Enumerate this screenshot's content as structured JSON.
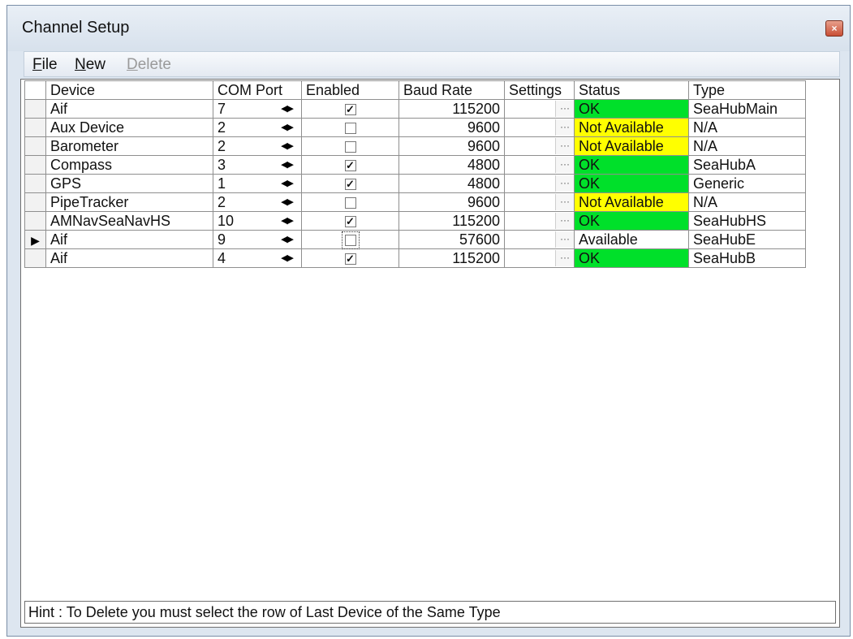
{
  "window": {
    "title": "Channel Setup",
    "close_glyph": "×"
  },
  "menu": {
    "file": "File",
    "new": "New",
    "delete": "Delete"
  },
  "columns": [
    "Device",
    "COM Port",
    "Enabled",
    "Baud Rate",
    "Settings",
    "Status",
    "Type"
  ],
  "rows": [
    {
      "device": "Aif",
      "port": "7",
      "enabled": true,
      "baud": "115200",
      "status": "OK",
      "status_kind": "ok",
      "type": "SeaHubMain",
      "current": false
    },
    {
      "device": "Aux Device",
      "port": "2",
      "enabled": false,
      "baud": "9600",
      "status": "Not Available",
      "status_kind": "na",
      "type": "N/A",
      "current": false
    },
    {
      "device": "Barometer",
      "port": "2",
      "enabled": false,
      "baud": "9600",
      "status": "Not Available",
      "status_kind": "na",
      "type": "N/A",
      "current": false
    },
    {
      "device": "Compass",
      "port": "3",
      "enabled": true,
      "baud": "4800",
      "status": "OK",
      "status_kind": "ok",
      "type": "SeaHubA",
      "current": false
    },
    {
      "device": "GPS",
      "port": "1",
      "enabled": true,
      "baud": "4800",
      "status": "OK",
      "status_kind": "ok",
      "type": "Generic",
      "current": false
    },
    {
      "device": "PipeTracker",
      "port": "2",
      "enabled": false,
      "baud": "9600",
      "status": "Not Available",
      "status_kind": "na",
      "type": "N/A",
      "current": false
    },
    {
      "device": "AMNavSeaNavHS",
      "port": "10",
      "enabled": true,
      "baud": "115200",
      "status": "OK",
      "status_kind": "ok",
      "type": "SeaHubHS",
      "current": false
    },
    {
      "device": "Aif",
      "port": "9",
      "enabled": false,
      "baud": "57600",
      "status": "Available",
      "status_kind": "av",
      "type": "SeaHubE",
      "current": true
    },
    {
      "device": "Aif",
      "port": "4",
      "enabled": true,
      "baud": "115200",
      "status": "OK",
      "status_kind": "ok",
      "type": "SeaHubB",
      "current": false
    }
  ],
  "glyphs": {
    "spin": "◀▶",
    "ellipsis": "···",
    "check": "✓",
    "row_pointer": "▶"
  },
  "colors": {
    "ok": "#00e02a",
    "not_available": "#ffff00",
    "available": "#ffffff"
  },
  "hint": "Hint : To Delete you must select the row of Last Device of the Same Type"
}
